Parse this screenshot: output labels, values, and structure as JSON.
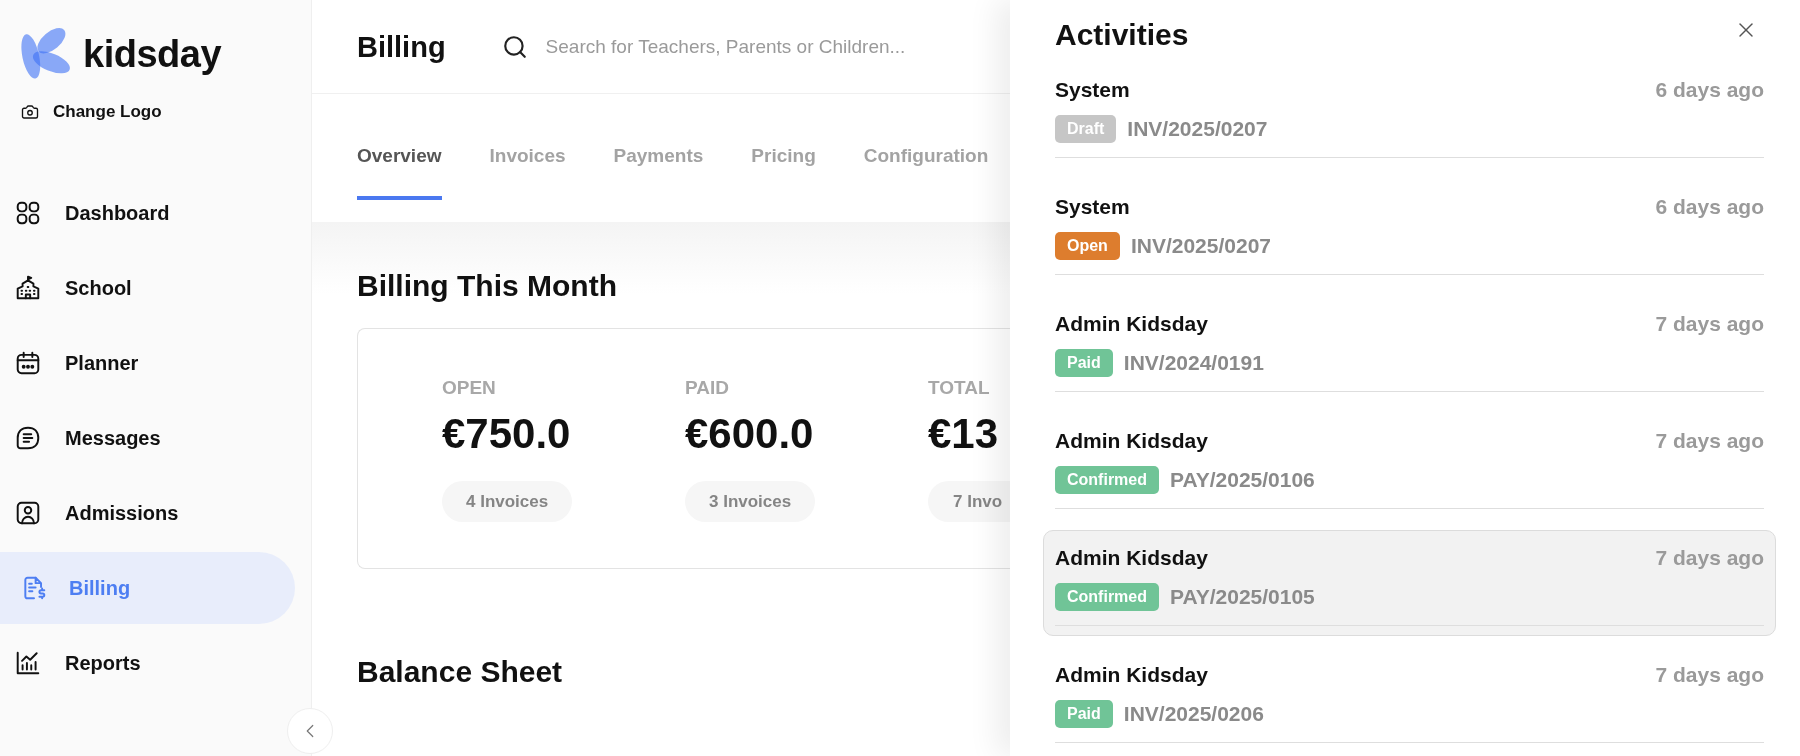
{
  "sidebar": {
    "logo_text": "kidsday",
    "change_logo": "Change Logo",
    "items": [
      {
        "label": "Dashboard",
        "selected": false
      },
      {
        "label": "School",
        "selected": false
      },
      {
        "label": "Planner",
        "selected": false
      },
      {
        "label": "Messages",
        "selected": false
      },
      {
        "label": "Admissions",
        "selected": false
      },
      {
        "label": "Billing",
        "selected": true
      },
      {
        "label": "Reports",
        "selected": false
      }
    ]
  },
  "header": {
    "title": "Billing",
    "search": {
      "placeholder": "Search for Teachers, Parents or Children..."
    }
  },
  "tabs": [
    {
      "label": "Overview",
      "selected": true
    },
    {
      "label": "Invoices",
      "selected": false
    },
    {
      "label": "Payments",
      "selected": false
    },
    {
      "label": "Pricing",
      "selected": false
    },
    {
      "label": "Configuration",
      "selected": false
    }
  ],
  "billing_this_month": {
    "title": "Billing This Month",
    "stats": [
      {
        "label": "OPEN",
        "amount": "€750.0",
        "count": "4 Invoices"
      },
      {
        "label": "PAID",
        "amount": "€600.0",
        "count": "3 Invoices"
      },
      {
        "label": "TOTAL",
        "amount": "€13",
        "count": "7 Invo"
      }
    ]
  },
  "balance_sheet": {
    "title": "Balance Sheet"
  },
  "activities": {
    "title": "Activities",
    "items": [
      {
        "actor": "System",
        "time": "6 days ago",
        "status": {
          "label": "Draft",
          "color": "#c6c6c6"
        },
        "reference": "INV/2025/0207",
        "selected": false
      },
      {
        "actor": "System",
        "time": "6 days ago",
        "status": {
          "label": "Open",
          "color": "#dd7d2e"
        },
        "reference": "INV/2025/0207",
        "selected": false
      },
      {
        "actor": "Admin Kidsday",
        "time": "7 days ago",
        "status": {
          "label": "Paid",
          "color": "#70c497"
        },
        "reference": "INV/2024/0191",
        "selected": false
      },
      {
        "actor": "Admin Kidsday",
        "time": "7 days ago",
        "status": {
          "label": "Confirmed",
          "color": "#70c497"
        },
        "reference": "PAY/2025/0106",
        "selected": false
      },
      {
        "actor": "Admin Kidsday",
        "time": "7 days ago",
        "status": {
          "label": "Confirmed",
          "color": "#70c497"
        },
        "reference": "PAY/2025/0105",
        "selected": true
      },
      {
        "actor": "Admin Kidsday",
        "time": "7 days ago",
        "status": {
          "label": "Paid",
          "color": "#70c497"
        },
        "reference": "INV/2025/0206",
        "selected": false
      }
    ]
  }
}
